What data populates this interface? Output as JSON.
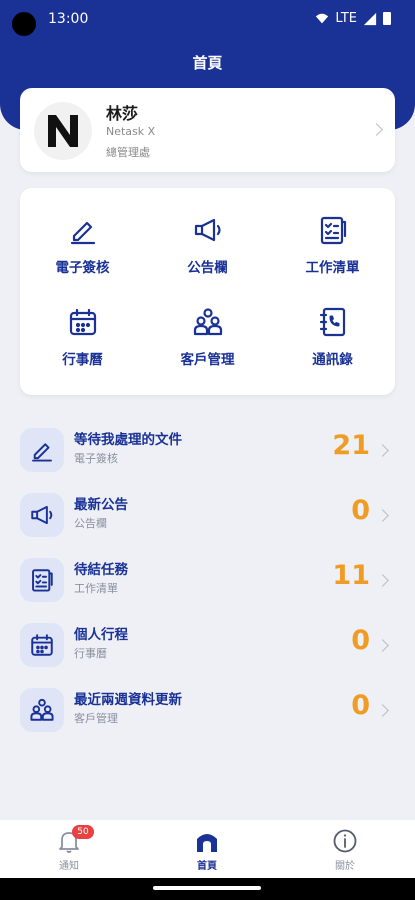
{
  "status_bar": {
    "time": "13:00",
    "network": "LTE"
  },
  "header": {
    "title": "首頁"
  },
  "profile": {
    "logo_letter": "N",
    "name": "林莎",
    "company": "Netask X",
    "department": "總管理處"
  },
  "shortcuts": [
    {
      "label": "電子簽核",
      "icon": "pen-icon"
    },
    {
      "label": "公告欄",
      "icon": "megaphone-icon"
    },
    {
      "label": "工作清單",
      "icon": "checklist-icon"
    },
    {
      "label": "行事曆",
      "icon": "calendar-icon"
    },
    {
      "label": "客戶管理",
      "icon": "people-icon"
    },
    {
      "label": "通訊錄",
      "icon": "contacts-book-icon"
    }
  ],
  "summary": [
    {
      "title": "等待我處理的文件",
      "subtitle": "電子簽核",
      "count": "21",
      "icon": "pen-icon"
    },
    {
      "title": "最新公告",
      "subtitle": "公告欄",
      "count": "0",
      "icon": "megaphone-icon"
    },
    {
      "title": "待結任務",
      "subtitle": "工作清單",
      "count": "11",
      "icon": "checklist-icon"
    },
    {
      "title": "個人行程",
      "subtitle": "行事曆",
      "count": "0",
      "icon": "calendar-icon"
    },
    {
      "title": "最近兩週資料更新",
      "subtitle": "客戶管理",
      "count": "0",
      "icon": "people-icon"
    }
  ],
  "bottom_nav": [
    {
      "label": "通知",
      "icon": "bell-icon",
      "badge": "50"
    },
    {
      "label": "首頁",
      "icon": "home-icon",
      "active": true
    },
    {
      "label": "關於",
      "icon": "info-icon"
    }
  ],
  "colors": {
    "primary": "#1a3296",
    "accent": "#f09b22",
    "badge": "#e84141",
    "background": "#eef0f5"
  }
}
